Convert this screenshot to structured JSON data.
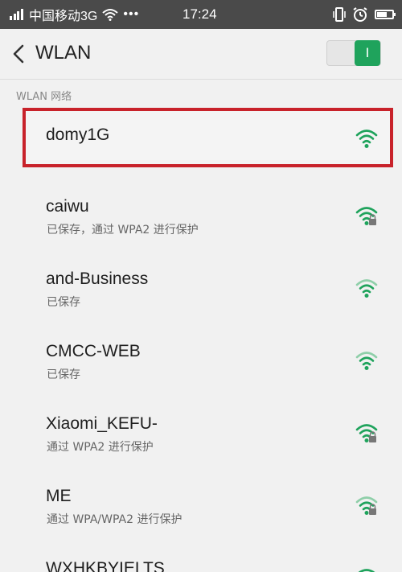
{
  "statusbar": {
    "carrier": "中国移动3G",
    "dots": "•••",
    "time": "17:24"
  },
  "header": {
    "title": "WLAN",
    "toggle_label": "I"
  },
  "section_label": "WLAN 网络",
  "networks": [
    {
      "name": "domy1G",
      "status": "",
      "locked": false
    },
    {
      "name": "caiwu",
      "status": "已保存，通过 WPA2 进行保护",
      "locked": true
    },
    {
      "name": "and-Business",
      "status": "已保存",
      "locked": false
    },
    {
      "name": "CMCC-WEB",
      "status": "已保存",
      "locked": false
    },
    {
      "name": "Xiaomi_KEFU-",
      "status": "通过 WPA2 进行保护",
      "locked": true
    },
    {
      "name": "ME",
      "status": "通过 WPA/WPA2 进行保护",
      "locked": true
    },
    {
      "name": "WXHKBYIELTS",
      "status": "",
      "locked": true
    }
  ],
  "colors": {
    "accent": "#1fa35c",
    "highlight": "#c8222a",
    "statusbar": "#4a4a4a"
  }
}
